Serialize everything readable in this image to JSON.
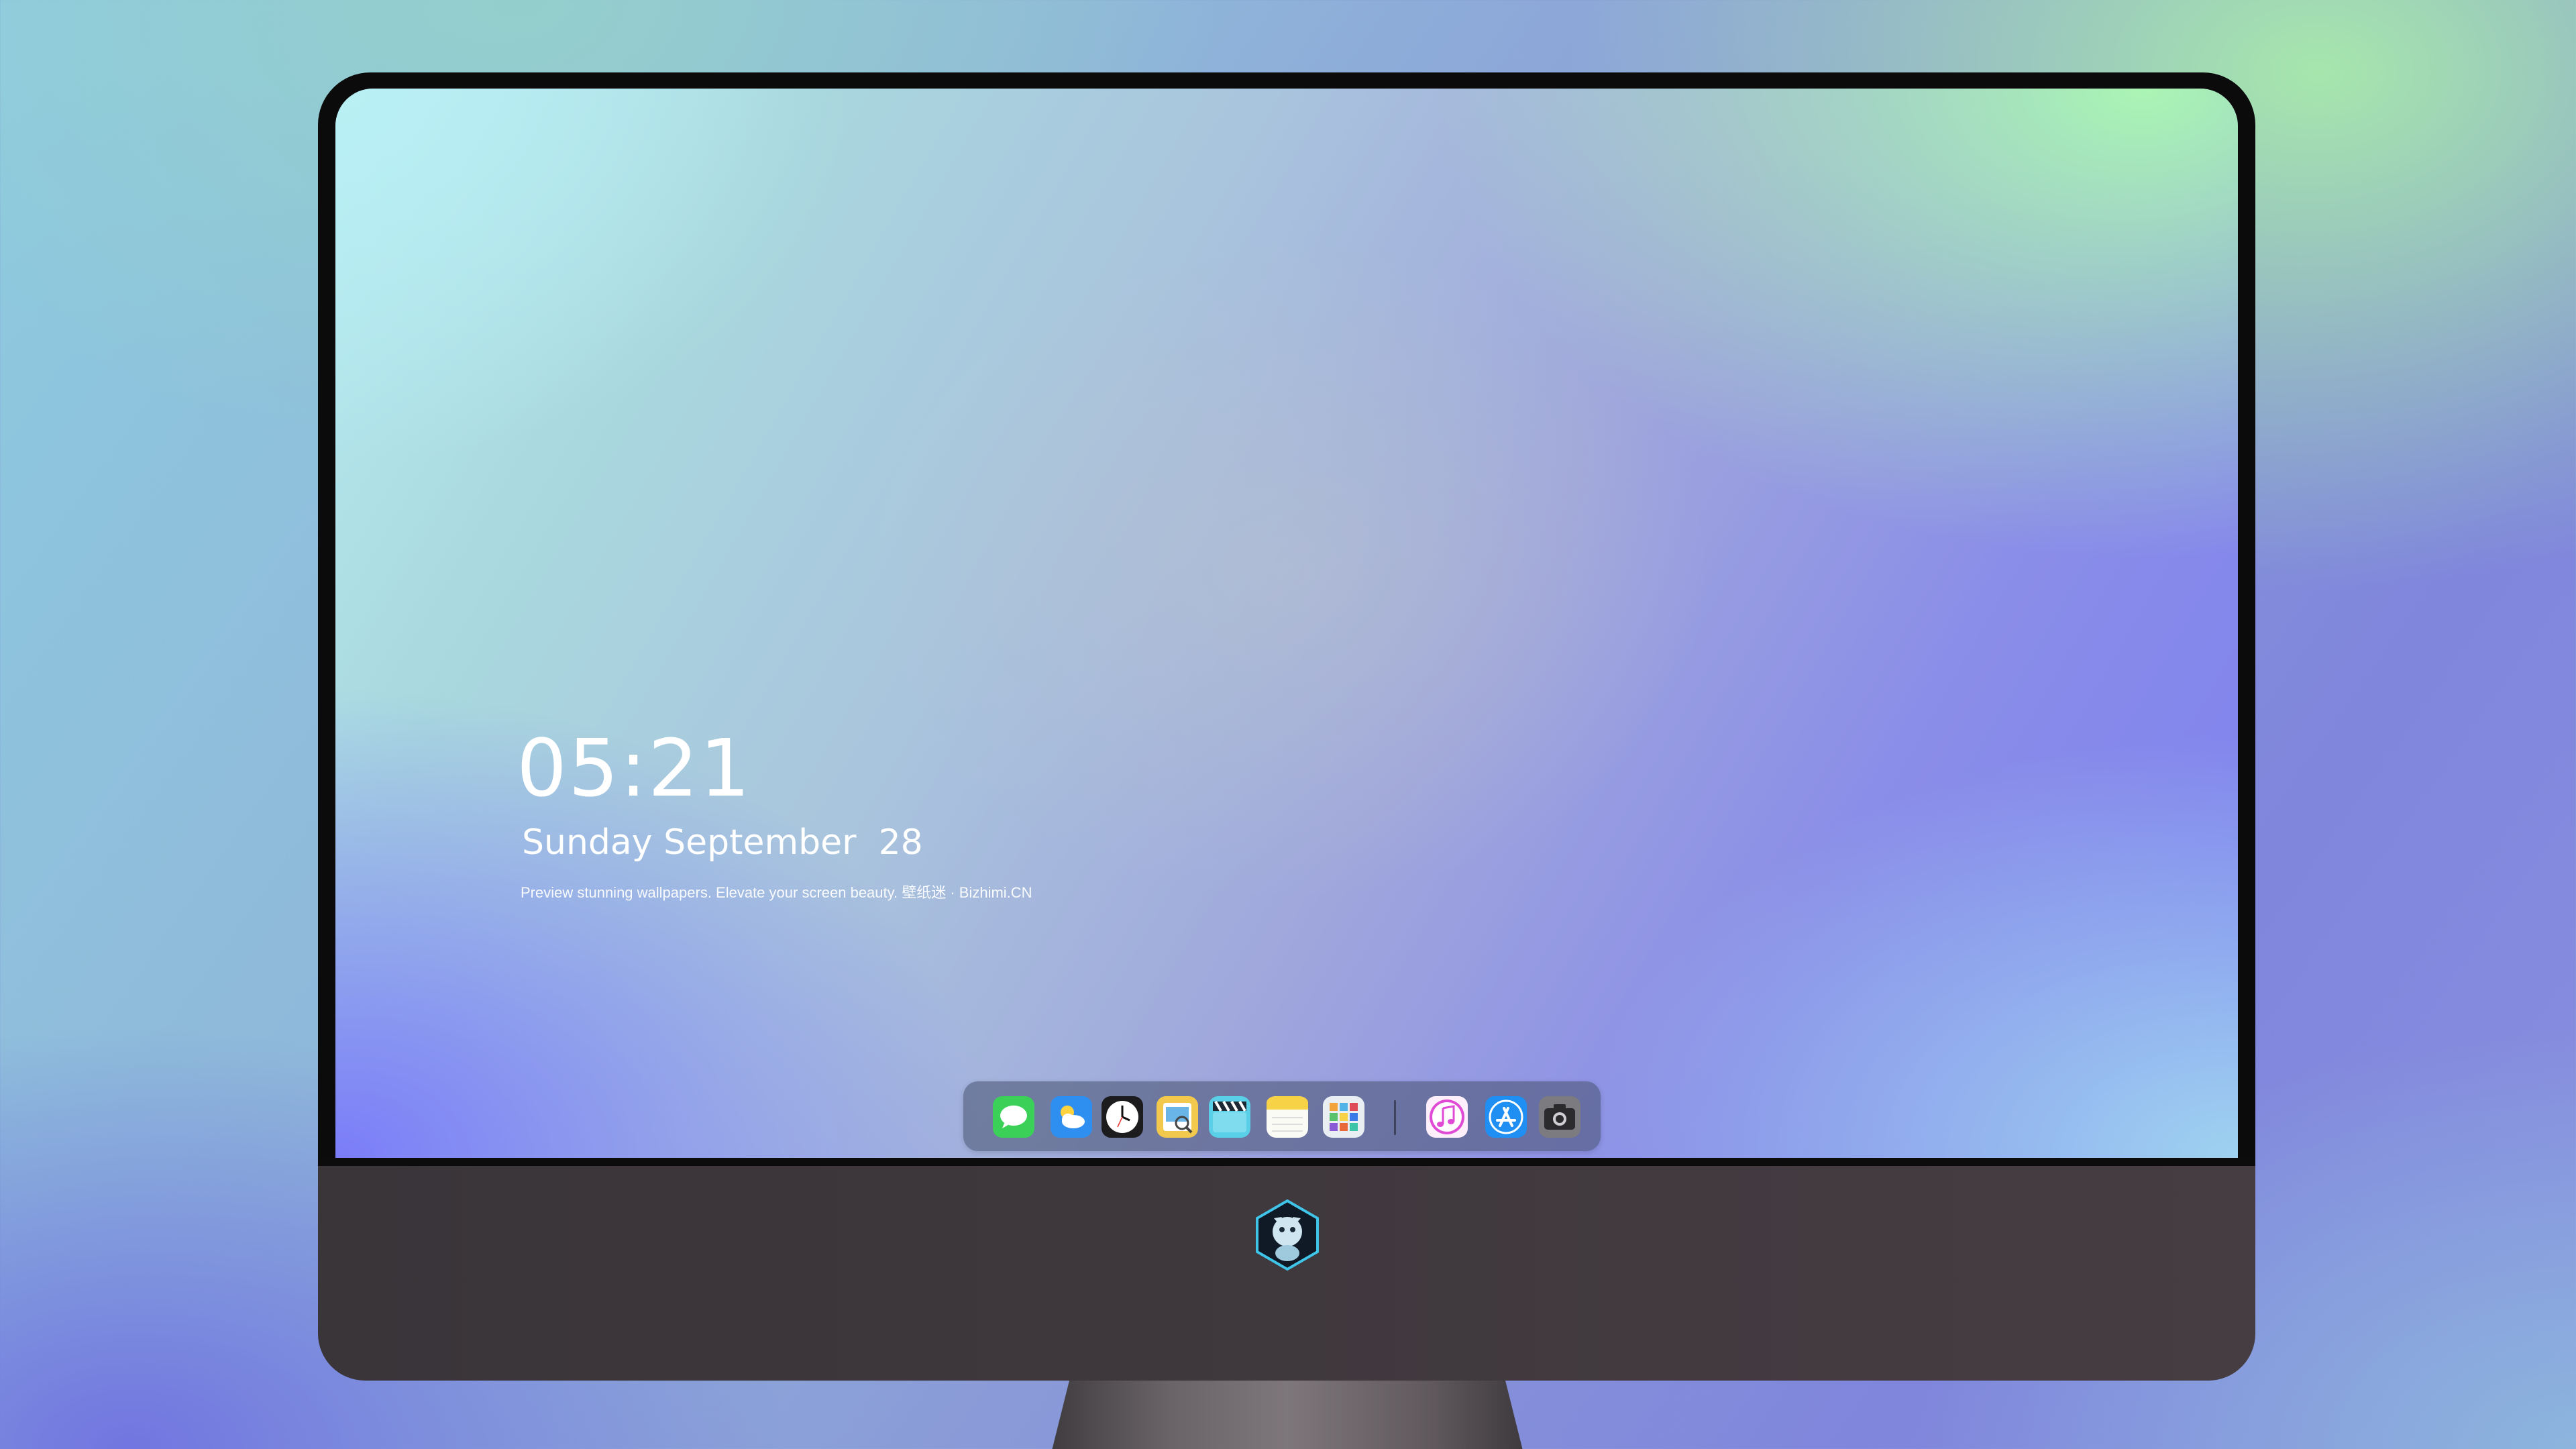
{
  "lock_screen": {
    "time": "05:21",
    "date": "Sunday September  28",
    "caption": "Preview stunning wallpapers. Elevate your screen beauty. 壁纸迷 · Bizhimi.CN"
  },
  "dock": {
    "apps": [
      {
        "name": "messages-icon",
        "color": "#3bd158"
      },
      {
        "name": "weather-icon",
        "color": "#2f8ff0"
      },
      {
        "name": "clock-icon",
        "color": "#1c1c1e"
      },
      {
        "name": "preview-icon",
        "color": "#f2c94c"
      },
      {
        "name": "clips-icon",
        "color": "#5ad0e8"
      },
      {
        "name": "notes-icon",
        "color": "#f7d247"
      },
      {
        "name": "calendar-grid-icon",
        "color": "#e8eef2"
      },
      {
        "name": "music-icon",
        "color": "#e04bd6"
      },
      {
        "name": "app-store-icon",
        "color": "#1f8ff3"
      },
      {
        "name": "camera-icon",
        "color": "#7b7b80"
      }
    ]
  },
  "colors": {
    "bezel": "#0b0b0c",
    "chin": "#3f383d",
    "text": "#ffffff"
  }
}
